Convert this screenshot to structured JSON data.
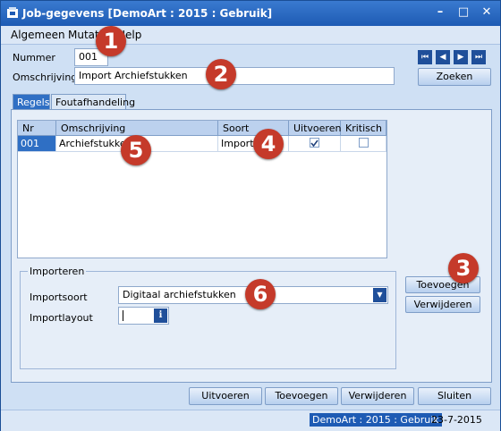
{
  "window": {
    "title": "Job-gegevens  [DemoArt : 2015 : Gebruik]",
    "minimize": "–",
    "maximize": "□",
    "close": "✕"
  },
  "menu": [
    "Algemeen",
    "Mutaties",
    "Help"
  ],
  "form": {
    "nummer_label": "Nummer",
    "nummer_value": "001",
    "omschrijving_label": "Omschrijving",
    "omschrijving_value": "Import Archiefstukken"
  },
  "nav": [
    "⏮",
    "◀",
    "▶",
    "⏭"
  ],
  "buttons": {
    "zoeken": "Zoeken",
    "toevoegen_side": "Toevoegen",
    "verwijderen_side": "Verwijderen",
    "uitvoeren": "Uitvoeren",
    "toevoegen": "Toevoegen",
    "verwijderen": "Verwijderen",
    "sluiten": "Sluiten"
  },
  "tabs": [
    "Regels",
    "Foutafhandeling"
  ],
  "grid": {
    "headers": [
      "Nr",
      "Omschrijving",
      "Soort",
      "Uitvoeren",
      "Kritisch"
    ],
    "rows": [
      {
        "nr": "001",
        "omschrijving": "Archiefstukken",
        "soort": "Import",
        "uitvoeren": true,
        "kritisch": false
      }
    ]
  },
  "importeren": {
    "legend": "Importeren",
    "importsoort_label": "Importsoort",
    "importsoort_value": "Digitaal archiefstukken",
    "importlayout_label": "Importlayout",
    "importlayout_value": ""
  },
  "callouts": [
    "1",
    "2",
    "3",
    "4",
    "5",
    "6"
  ],
  "status": {
    "context": "DemoArt : 2015 : Gebruik",
    "date": "23-7-2015"
  },
  "colors": {
    "titlebar": "#1e5bb4",
    "callout": "#c53a2a",
    "selection": "#2f6fc4"
  }
}
